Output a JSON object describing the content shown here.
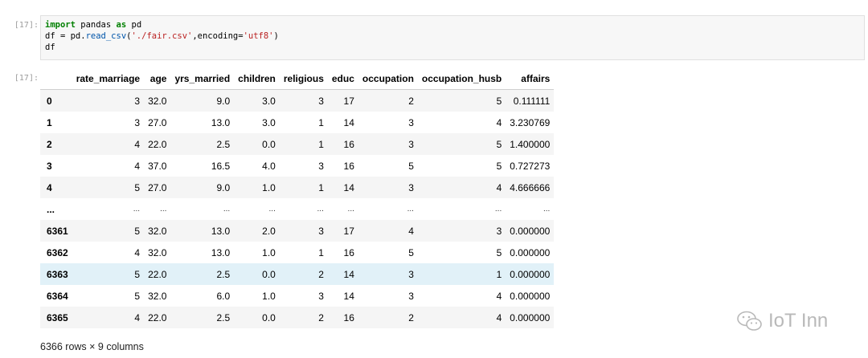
{
  "input_prompt": "[17]:",
  "output_prompt": "[17]:",
  "code": {
    "line1": {
      "kw1": "import",
      "mod": " pandas ",
      "kw2": "as",
      "alias": " pd"
    },
    "line2": {
      "pre": "df = pd.",
      "fn": "read_csv",
      "open": "(",
      "s1": "'./fair.csv'",
      "mid": ",encoding=",
      "s2": "'utf8'",
      "close": ")"
    },
    "line3": "df"
  },
  "table": {
    "columns": [
      "",
      "rate_marriage",
      "age",
      "yrs_married",
      "children",
      "religious",
      "educ",
      "occupation",
      "occupation_husb",
      "affairs"
    ],
    "rows": [
      [
        "0",
        "3",
        "32.0",
        "9.0",
        "3.0",
        "3",
        "17",
        "2",
        "5",
        "0.111111"
      ],
      [
        "1",
        "3",
        "27.0",
        "13.0",
        "3.0",
        "1",
        "14",
        "3",
        "4",
        "3.230769"
      ],
      [
        "2",
        "4",
        "22.0",
        "2.5",
        "0.0",
        "1",
        "16",
        "3",
        "5",
        "1.400000"
      ],
      [
        "3",
        "4",
        "37.0",
        "16.5",
        "4.0",
        "3",
        "16",
        "5",
        "5",
        "0.727273"
      ],
      [
        "4",
        "5",
        "27.0",
        "9.0",
        "1.0",
        "1",
        "14",
        "3",
        "4",
        "4.666666"
      ],
      [
        "...",
        "...",
        "...",
        "...",
        "...",
        "...",
        "...",
        "...",
        "...",
        "..."
      ],
      [
        "6361",
        "5",
        "32.0",
        "13.0",
        "2.0",
        "3",
        "17",
        "4",
        "3",
        "0.000000"
      ],
      [
        "6362",
        "4",
        "32.0",
        "13.0",
        "1.0",
        "1",
        "16",
        "5",
        "5",
        "0.000000"
      ],
      [
        "6363",
        "5",
        "22.0",
        "2.5",
        "0.0",
        "2",
        "14",
        "3",
        "1",
        "0.000000"
      ],
      [
        "6364",
        "5",
        "32.0",
        "6.0",
        "1.0",
        "3",
        "14",
        "3",
        "4",
        "0.000000"
      ],
      [
        "6365",
        "4",
        "22.0",
        "2.5",
        "0.0",
        "2",
        "16",
        "2",
        "4",
        "0.000000"
      ]
    ],
    "highlighted_row_index": 8
  },
  "shape_text": "6366 rows × 9 columns",
  "watermark": {
    "icon": "wechat-icon",
    "text": "IoT Inn"
  }
}
